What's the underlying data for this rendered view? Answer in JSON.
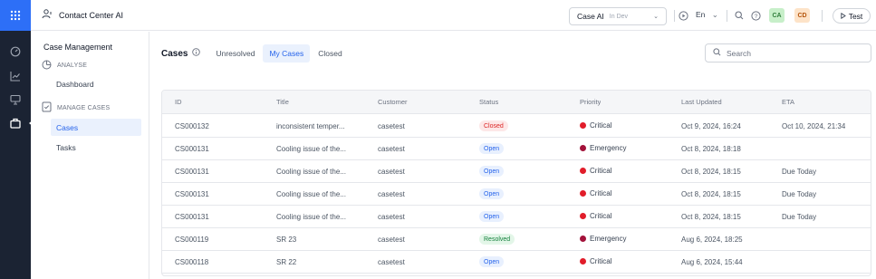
{
  "app": {
    "title": "Contact Center AI"
  },
  "environment": {
    "name": "Case AI",
    "state": "In Dev"
  },
  "language": "En",
  "avatars": [
    {
      "initials": "CA",
      "bg": "#c7efc9",
      "fg": "#2f7d3a"
    },
    {
      "initials": "CD",
      "bg": "#fde3c8",
      "fg": "#b45309"
    }
  ],
  "test_button": {
    "label": "Test"
  },
  "sidebar": {
    "title": "Case Management",
    "sections": [
      {
        "label": "ANALYSE",
        "items": [
          {
            "label": "Dashboard",
            "selected": false
          }
        ]
      },
      {
        "label": "MANAGE CASES",
        "items": [
          {
            "label": "Cases",
            "selected": true
          },
          {
            "label": "Tasks",
            "selected": false
          }
        ]
      }
    ]
  },
  "main": {
    "title": "Cases",
    "tabs": [
      {
        "label": "Unresolved",
        "active": false
      },
      {
        "label": "My Cases",
        "active": true
      },
      {
        "label": "Closed",
        "active": false
      }
    ],
    "search": {
      "placeholder": "Search",
      "value": ""
    }
  },
  "table": {
    "columns": [
      "ID",
      "Title",
      "Customer",
      "Status",
      "Priority",
      "Last Updated",
      "ETA"
    ],
    "rows": [
      {
        "id": "CS000132",
        "title": "inconsistent temper...",
        "customer": "casetest",
        "status": "Closed",
        "priority": "Critical",
        "updated": "Oct 9, 2024, 16:24",
        "eta": "Oct 10, 2024, 21:34"
      },
      {
        "id": "CS000131",
        "title": "Cooling issue of the...",
        "customer": "casetest",
        "status": "Open",
        "priority": "Emergency",
        "updated": "Oct 8, 2024, 18:18",
        "eta": ""
      },
      {
        "id": "CS000131",
        "title": "Cooling issue of the...",
        "customer": "casetest",
        "status": "Open",
        "priority": "Critical",
        "updated": "Oct 8, 2024, 18:15",
        "eta": "Due Today"
      },
      {
        "id": "CS000131",
        "title": "Cooling issue of the...",
        "customer": "casetest",
        "status": "Open",
        "priority": "Critical",
        "updated": "Oct 8, 2024, 18:15",
        "eta": "Due Today"
      },
      {
        "id": "CS000131",
        "title": "Cooling issue of the...",
        "customer": "casetest",
        "status": "Open",
        "priority": "Critical",
        "updated": "Oct 8, 2024, 18:15",
        "eta": "Due Today"
      },
      {
        "id": "CS000119",
        "title": "SR 23",
        "customer": "casetest",
        "status": "Resolved",
        "priority": "Emergency",
        "updated": "Aug 6, 2024, 18:25",
        "eta": ""
      },
      {
        "id": "CS000118",
        "title": "SR 22",
        "customer": "casetest",
        "status": "Open",
        "priority": "Critical",
        "updated": "Aug 6, 2024, 15:44",
        "eta": ""
      }
    ]
  },
  "colors": {
    "accent": "#2563eb",
    "rail": "#1b2333",
    "apps_tile": "#2d6ff7",
    "critical": "#e11d2a",
    "emergency": "#a3123a"
  }
}
